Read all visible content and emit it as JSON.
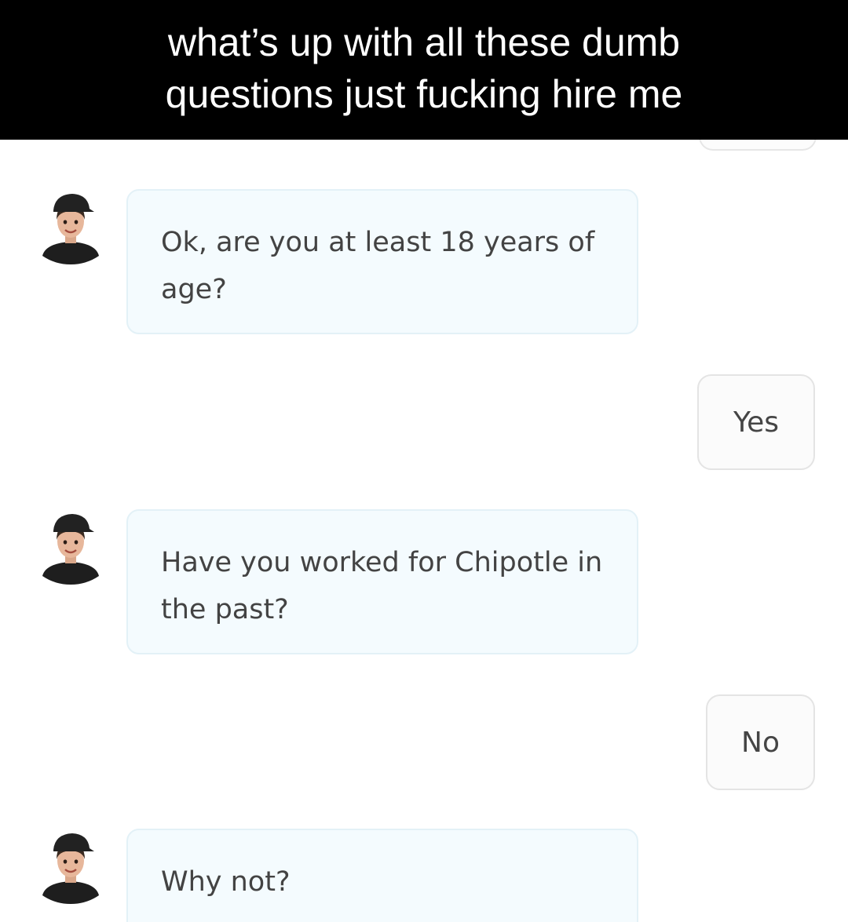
{
  "caption": {
    "text": "what’s up with all these dumb questions just fucking hire me"
  },
  "chat": {
    "messages": [
      {
        "sender": "bot",
        "avatar_icon": "chipotle-crew-avatar-icon",
        "text": "Ok, are you at least 18 years of age?"
      },
      {
        "sender": "user",
        "text": "Yes"
      },
      {
        "sender": "bot",
        "avatar_icon": "chipotle-crew-avatar-icon",
        "text": "Have you worked for Chipotle in the past?"
      },
      {
        "sender": "user",
        "text": "No"
      },
      {
        "sender": "bot",
        "avatar_icon": "chipotle-crew-avatar-icon",
        "text": "Why not?"
      }
    ]
  },
  "colors": {
    "caption_background": "#000000",
    "caption_text": "#ffffff",
    "bot_bubble_background": "#f4fbfe",
    "bot_bubble_border": "#e3f1f7",
    "user_bubble_background": "#fbfbfb",
    "user_bubble_border": "#e4e4e4",
    "message_text": "#434343"
  }
}
